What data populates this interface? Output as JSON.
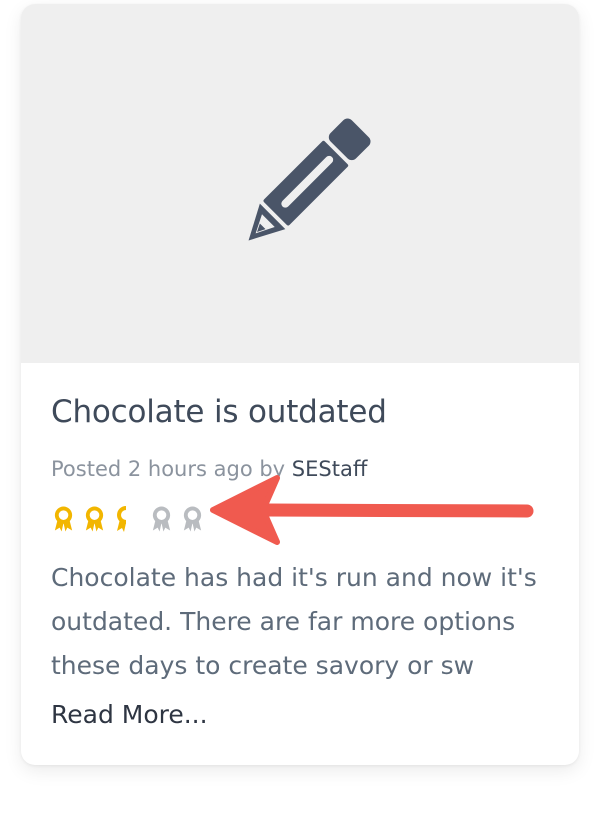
{
  "post": {
    "image_icon": "pencil-icon",
    "title": "Chocolate is outdated",
    "meta_prefix": "Posted 2 hours ago by ",
    "author": "SEStaff",
    "excerpt": "Chocolate has had it's run and now it's outdated. There are far more options these days to create savory or sw",
    "read_more": "Read More..."
  },
  "rating": {
    "icon": "award-ribbon-icon",
    "value": 2.5,
    "max": 5,
    "filled_color": "#f2b600",
    "empty_color": "#b9bcc0"
  },
  "annotation": {
    "icon": "red-arrow-icon",
    "color": "#f05a4f"
  },
  "colors": {
    "image_background": "#efefef",
    "pencil": "#4a5568"
  }
}
